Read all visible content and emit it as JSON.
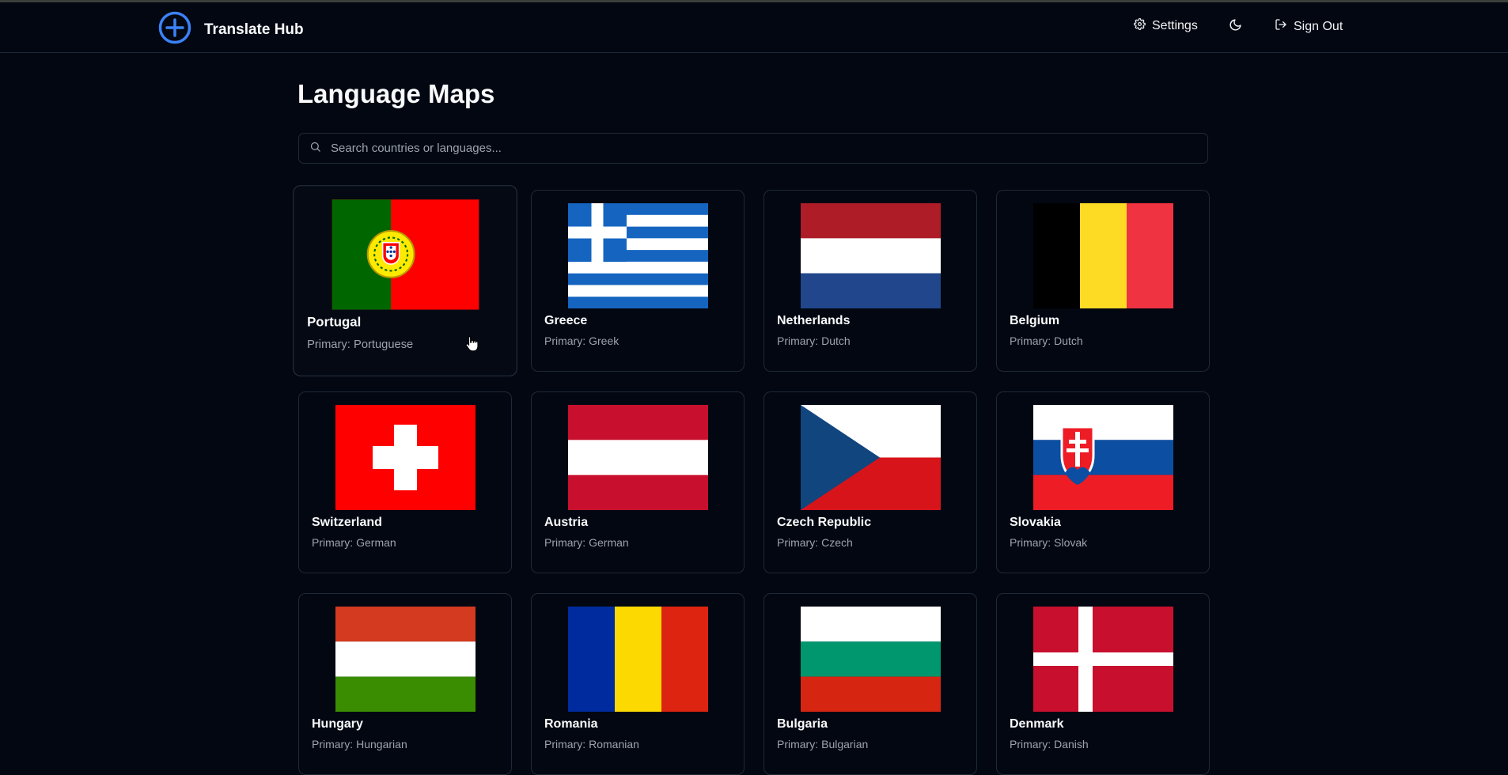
{
  "header": {
    "app_title": "Translate Hub",
    "logo_icon": "plus-circle-icon",
    "settings_label": "Settings",
    "signout_label": "Sign Out",
    "theme_icon": "moon-icon",
    "accent_color": "#3b82f6"
  },
  "main": {
    "title": "Language Maps",
    "search": {
      "placeholder": "Search countries or languages...",
      "value": ""
    },
    "primary_prefix": "Primary:",
    "countries": [
      {
        "name": "Portugal",
        "language": "Portuguese",
        "flag": "portugal-flag"
      },
      {
        "name": "Greece",
        "language": "Greek",
        "flag": "greece-flag"
      },
      {
        "name": "Netherlands",
        "language": "Dutch",
        "flag": "netherlands-flag"
      },
      {
        "name": "Belgium",
        "language": "Dutch",
        "flag": "belgium-flag"
      },
      {
        "name": "Switzerland",
        "language": "German",
        "flag": "switzerland-flag"
      },
      {
        "name": "Austria",
        "language": "German",
        "flag": "austria-flag"
      },
      {
        "name": "Czech Republic",
        "language": "Czech",
        "flag": "czech-flag"
      },
      {
        "name": "Slovakia",
        "language": "Slovak",
        "flag": "slovakia-flag"
      },
      {
        "name": "Hungary",
        "language": "Hungarian",
        "flag": "hungary-flag"
      },
      {
        "name": "Romania",
        "language": "Romanian",
        "flag": "romania-flag"
      },
      {
        "name": "Bulgaria",
        "language": "Bulgarian",
        "flag": "bulgaria-flag"
      },
      {
        "name": "Denmark",
        "language": "Danish",
        "flag": "denmark-flag"
      }
    ]
  }
}
